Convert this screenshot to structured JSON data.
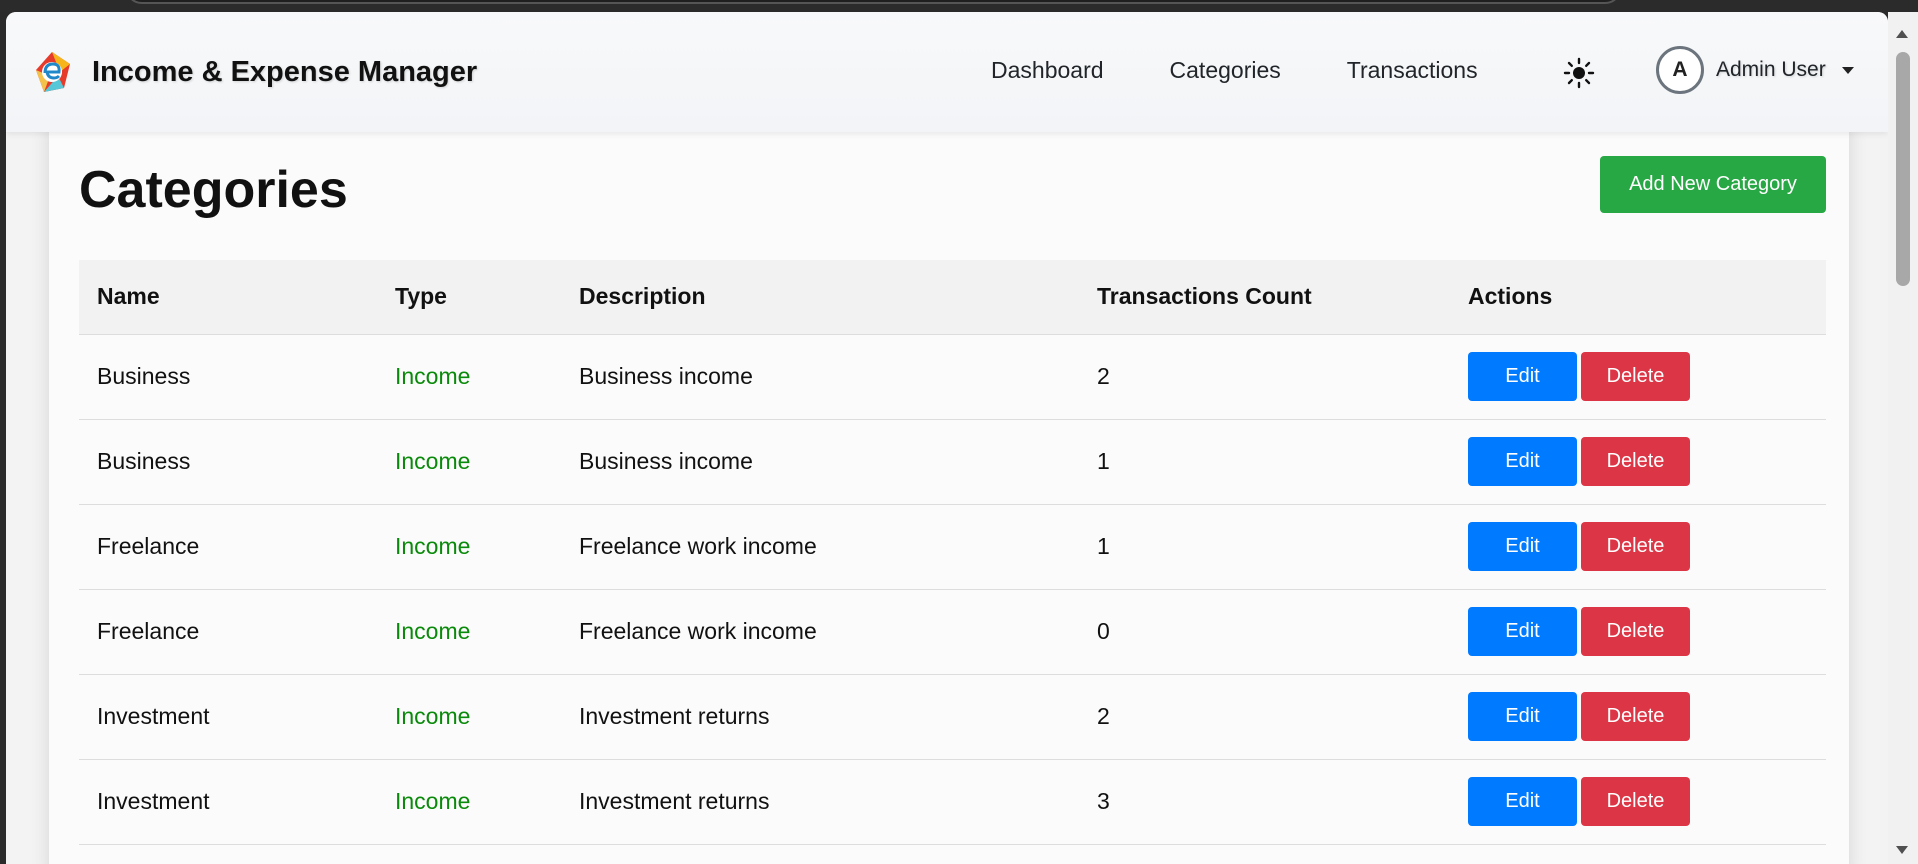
{
  "app": {
    "title": "Income & Expense Manager"
  },
  "nav": {
    "links": [
      "Dashboard",
      "Categories",
      "Transactions"
    ],
    "theme_icon": "sun-icon",
    "user": {
      "avatar_initial": "A",
      "name": "Admin User"
    }
  },
  "page": {
    "title": "Categories",
    "add_button_label": "Add New Category"
  },
  "table": {
    "headers": [
      "Name",
      "Type",
      "Description",
      "Transactions Count",
      "Actions"
    ],
    "rows": [
      {
        "name": "Business",
        "type": "Income",
        "description": "Business income",
        "count": "2"
      },
      {
        "name": "Business",
        "type": "Income",
        "description": "Business income",
        "count": "1"
      },
      {
        "name": "Freelance",
        "type": "Income",
        "description": "Freelance work income",
        "count": "1"
      },
      {
        "name": "Freelance",
        "type": "Income",
        "description": "Freelance work income",
        "count": "0"
      },
      {
        "name": "Investment",
        "type": "Income",
        "description": "Investment returns",
        "count": "2"
      },
      {
        "name": "Investment",
        "type": "Income",
        "description": "Investment returns",
        "count": "3"
      }
    ],
    "edit_label": "Edit",
    "delete_label": "Delete"
  },
  "colors": {
    "primary": "#007bff",
    "success": "#28a745",
    "danger": "#dc3545",
    "income_text": "#0a8a0a"
  }
}
